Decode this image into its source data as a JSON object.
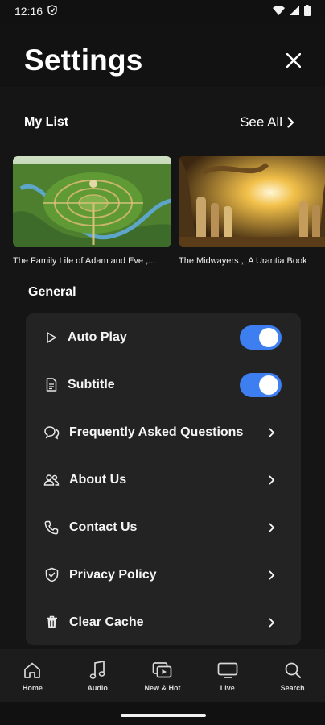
{
  "status_bar": {
    "time": "12:16"
  },
  "header": {
    "title": "Settings"
  },
  "my_list": {
    "title": "My List",
    "see_all_label": "See All",
    "items": [
      {
        "caption": "The Family Life of Adam and Eve ,..."
      },
      {
        "caption": "The Midwayers ,, A Urantia Book"
      }
    ]
  },
  "general": {
    "title": "General",
    "items": [
      {
        "label": "Auto Play",
        "icon": "play-icon",
        "control": "toggle",
        "checked": true
      },
      {
        "label": "Subtitle",
        "icon": "document-icon",
        "control": "toggle",
        "checked": true
      },
      {
        "label": "Frequently Asked Questions",
        "icon": "chat-bubbles-icon",
        "control": "chevron"
      },
      {
        "label": "About Us",
        "icon": "people-icon",
        "control": "chevron"
      },
      {
        "label": "Contact Us",
        "icon": "phone-icon",
        "control": "chevron"
      },
      {
        "label": "Privacy Policy",
        "icon": "shield-icon",
        "control": "chevron"
      },
      {
        "label": "Clear Cache",
        "icon": "trash-icon",
        "control": "chevron"
      }
    ]
  },
  "bottom_nav": {
    "items": [
      {
        "label": "Home",
        "icon": "home-icon"
      },
      {
        "label": "Audio",
        "icon": "music-note-icon"
      },
      {
        "label": "New & Hot",
        "icon": "play-stack-icon"
      },
      {
        "label": "Live",
        "icon": "tv-icon"
      },
      {
        "label": "Search",
        "icon": "search-icon"
      }
    ]
  },
  "colors": {
    "accent": "#3d7ff0",
    "background": "#151515",
    "panel": "#232323",
    "nav": "#1c1c1c"
  }
}
